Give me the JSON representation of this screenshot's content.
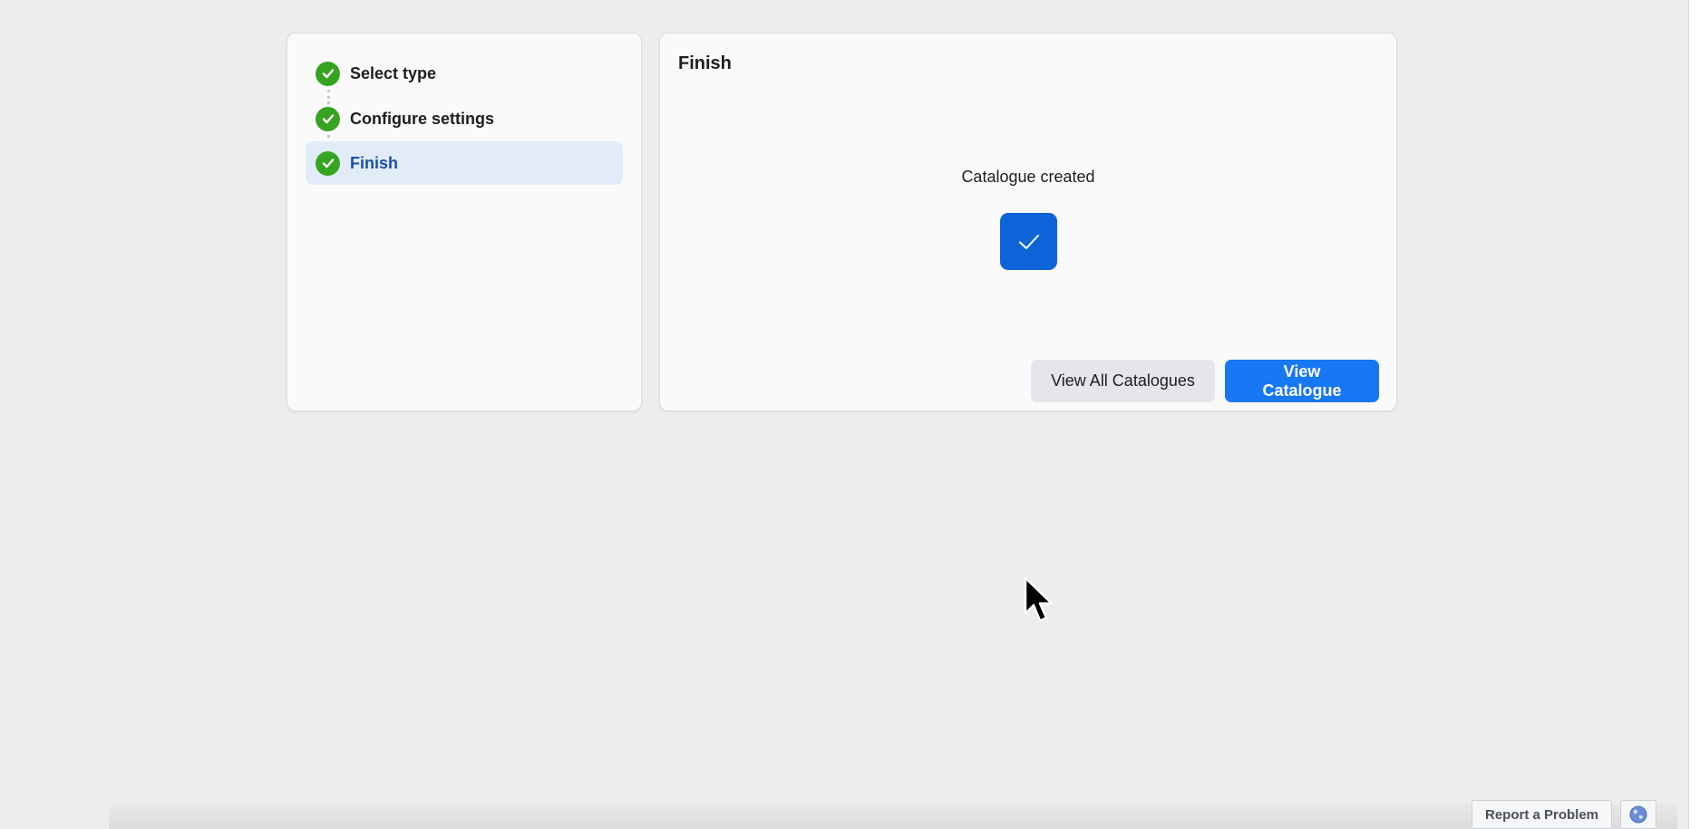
{
  "steps": [
    {
      "label": "Select type",
      "status": "complete",
      "icon": "check-circle-icon"
    },
    {
      "label": "Configure settings",
      "status": "complete",
      "icon": "check-circle-icon"
    },
    {
      "label": "Finish",
      "status": "complete",
      "active": true,
      "icon": "check-circle-icon"
    }
  ],
  "finish": {
    "title": "Finish",
    "message": "Catalogue created",
    "badge_icon": "checkmark-icon",
    "secondary_button": "View All Catalogues",
    "primary_button": "View Catalogue"
  },
  "footer": {
    "report_label": "Report a Problem",
    "globe_icon": "globe-icon"
  },
  "colors": {
    "accent": "#1877f2",
    "badge": "#0d64d8",
    "success": "#36a420",
    "active_step_bg": "#e2ecf8",
    "active_step_text": "#1a4fa8",
    "background": "#ededed"
  }
}
